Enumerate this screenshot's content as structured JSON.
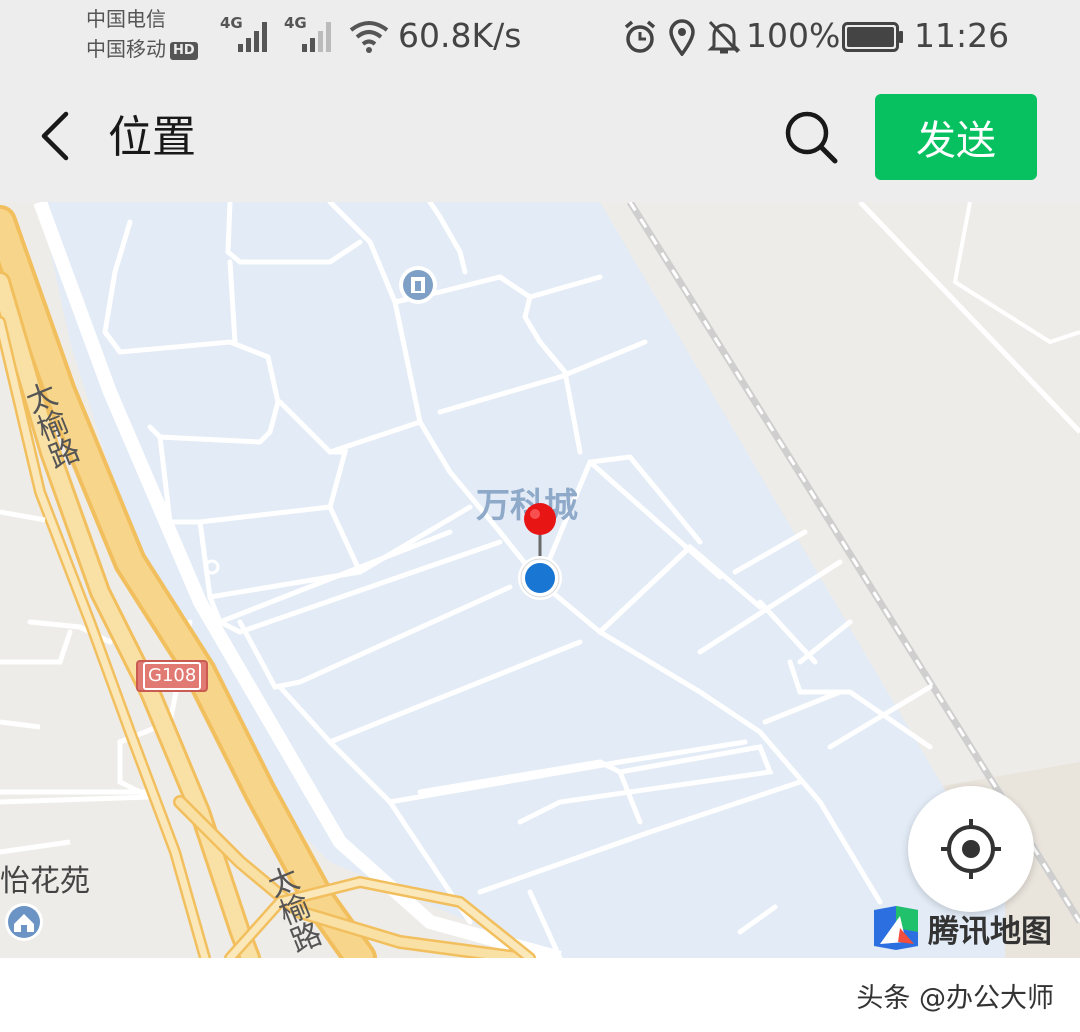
{
  "status_bar": {
    "carrier_1": "中国电信",
    "carrier_2": "中国移动",
    "hd_badge": "HD",
    "net_1": "4G",
    "net_2": "4G",
    "speed": "60.8K/s",
    "battery": "100%",
    "time": "11:26"
  },
  "navbar": {
    "title": "位置",
    "send_label": "发送"
  },
  "map": {
    "place_name": "万科城",
    "road_label_1": "太榆路",
    "road_label_2": "太榆路",
    "highway_badge": "G108",
    "poi_partial": "怡花苑",
    "provider": "腾讯地图"
  },
  "footer": {
    "watermark": "头条 @办公大师"
  },
  "colors": {
    "send_green": "#07c160",
    "pin_red": "#e81515",
    "location_blue": "#1976d2",
    "district_fill": "#e2ebf6",
    "highway_yellow": "#f7cf7a",
    "badge_red": "#e07a72"
  }
}
